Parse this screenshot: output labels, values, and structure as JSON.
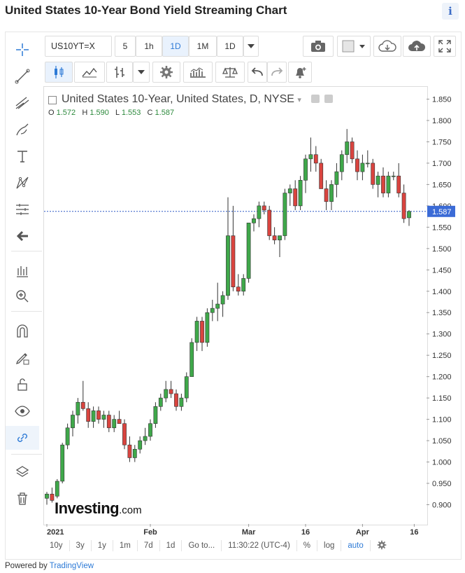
{
  "page_title": "United States 10-Year Bond Yield Streaming Chart",
  "info_icon_glyph": "i",
  "toolbar": {
    "symbol": "US10YT=X",
    "intervals": [
      "5",
      "1h",
      "1D",
      "1M",
      "1D"
    ],
    "selected_interval": "1D",
    "icons": [
      "camera-icon",
      "color-square-icon",
      "dropdown-arrow-icon",
      "cloud-download-icon",
      "cloud-upload-icon",
      "fullscreen-icon"
    ]
  },
  "second_toolbar_icons": [
    "candle-style-icon",
    "indicator-icon",
    "bar-type-icon",
    "dropdown-arrow-icon",
    "gear-icon",
    "compare-icon",
    "scale-icon",
    "undo-icon",
    "redo-icon",
    "alert-icon"
  ],
  "left_tools": [
    "crosshair-icon",
    "trend-line-icon",
    "pitchfork-icon",
    "brush-icon",
    "text-icon",
    "pattern-icon",
    "measure-icon",
    "back-arrow-icon",
    "indicators-icon",
    "zoom-in-icon",
    "magnet-icon",
    "lock-draw-icon",
    "unlock-icon",
    "eye-icon",
    "link-icon",
    "layers-icon",
    "trash-icon"
  ],
  "legend": {
    "title": "United States 10-Year, United States, D, NYSE",
    "o_label": "O",
    "o": "1.572",
    "h_label": "H",
    "h": "1.590",
    "l_label": "L",
    "l": "1.553",
    "c_label": "C",
    "c": "1.587"
  },
  "logo_text": "Investing",
  "logo_suffix": ".com",
  "bottom_bar": {
    "ranges": [
      "10y",
      "3y",
      "1y",
      "1m",
      "7d",
      "1d"
    ],
    "goto": "Go to...",
    "time": "11:30:22 (UTC-4)",
    "percent": "%",
    "log": "log",
    "auto": "auto"
  },
  "powered_by": "Powered by",
  "powered_brand": "TradingView",
  "colors": {
    "up": "#3fa84a",
    "down": "#d9443f",
    "price_line": "#2d59c6",
    "label_bg": "#3b6bd6"
  },
  "chart_data": {
    "type": "candlestick",
    "title": "United States 10-Year, United States, D, NYSE",
    "current_price": 1.587,
    "current_price_label": "1.587",
    "ylim": [
      0.87,
      1.87
    ],
    "yticks": [
      "0.900",
      "0.950",
      "1.000",
      "1.050",
      "1.100",
      "1.150",
      "1.200",
      "1.250",
      "1.300",
      "1.350",
      "1.400",
      "1.450",
      "1.500",
      "1.550",
      "1.600",
      "1.650",
      "1.700",
      "1.750",
      "1.800",
      "1.850"
    ],
    "xtick_labels": [
      "2021",
      "Feb",
      "Mar",
      "16",
      "Apr",
      "16"
    ],
    "xtick_index": [
      0,
      20,
      39,
      50,
      61,
      71
    ],
    "ohlc": [
      [
        0.915,
        0.93,
        0.9,
        0.925
      ],
      [
        0.925,
        0.94,
        0.905,
        0.91
      ],
      [
        0.92,
        0.96,
        0.915,
        0.955
      ],
      [
        0.955,
        1.045,
        0.95,
        1.04
      ],
      [
        1.04,
        1.09,
        1.03,
        1.08
      ],
      [
        1.08,
        1.12,
        1.06,
        1.11
      ],
      [
        1.11,
        1.15,
        1.09,
        1.14
      ],
      [
        1.14,
        1.19,
        1.12,
        1.125
      ],
      [
        1.125,
        1.14,
        1.08,
        1.095
      ],
      [
        1.095,
        1.13,
        1.08,
        1.12
      ],
      [
        1.12,
        1.13,
        1.09,
        1.1
      ],
      [
        1.1,
        1.12,
        1.08,
        1.11
      ],
      [
        1.11,
        1.12,
        1.07,
        1.08
      ],
      [
        1.08,
        1.11,
        1.07,
        1.1
      ],
      [
        1.1,
        1.12,
        1.09,
        1.09
      ],
      [
        1.09,
        1.1,
        1.03,
        1.04
      ],
      [
        1.04,
        1.06,
        1.0,
        1.01
      ],
      [
        1.01,
        1.04,
        1.0,
        1.03
      ],
      [
        1.03,
        1.06,
        1.02,
        1.05
      ],
      [
        1.05,
        1.08,
        1.04,
        1.06
      ],
      [
        1.06,
        1.1,
        1.05,
        1.09
      ],
      [
        1.09,
        1.14,
        1.08,
        1.13
      ],
      [
        1.13,
        1.16,
        1.12,
        1.15
      ],
      [
        1.15,
        1.19,
        1.14,
        1.17
      ],
      [
        1.17,
        1.19,
        1.15,
        1.16
      ],
      [
        1.16,
        1.17,
        1.12,
        1.13
      ],
      [
        1.13,
        1.16,
        1.12,
        1.15
      ],
      [
        1.15,
        1.21,
        1.14,
        1.2
      ],
      [
        1.2,
        1.29,
        1.22,
        1.28
      ],
      [
        1.28,
        1.34,
        1.26,
        1.33
      ],
      [
        1.33,
        1.34,
        1.26,
        1.28
      ],
      [
        1.28,
        1.36,
        1.27,
        1.35
      ],
      [
        1.35,
        1.38,
        1.33,
        1.36
      ],
      [
        1.36,
        1.42,
        1.33,
        1.37
      ],
      [
        1.37,
        1.4,
        1.34,
        1.39
      ],
      [
        1.39,
        1.62,
        1.38,
        1.53
      ],
      [
        1.53,
        1.6,
        1.4,
        1.41
      ],
      [
        1.41,
        1.44,
        1.39,
        1.4
      ],
      [
        1.4,
        1.44,
        1.39,
        1.43
      ],
      [
        1.43,
        1.56,
        1.42,
        1.56
      ],
      [
        1.56,
        1.58,
        1.54,
        1.57
      ],
      [
        1.57,
        1.61,
        1.55,
        1.6
      ],
      [
        1.6,
        1.61,
        1.58,
        1.59
      ],
      [
        1.59,
        1.6,
        1.52,
        1.53
      ],
      [
        1.53,
        1.55,
        1.51,
        1.52
      ],
      [
        1.52,
        1.53,
        1.48,
        1.53
      ],
      [
        1.53,
        1.64,
        1.52,
        1.63
      ],
      [
        1.63,
        1.65,
        1.6,
        1.64
      ],
      [
        1.64,
        1.66,
        1.59,
        1.6
      ],
      [
        1.6,
        1.67,
        1.59,
        1.66
      ],
      [
        1.66,
        1.72,
        1.63,
        1.71
      ],
      [
        1.71,
        1.76,
        1.68,
        1.72
      ],
      [
        1.72,
        1.74,
        1.68,
        1.7
      ],
      [
        1.7,
        1.71,
        1.64,
        1.64
      ],
      [
        1.64,
        1.66,
        1.59,
        1.61
      ],
      [
        1.61,
        1.66,
        1.59,
        1.65
      ],
      [
        1.65,
        1.7,
        1.62,
        1.68
      ],
      [
        1.68,
        1.73,
        1.66,
        1.72
      ],
      [
        1.72,
        1.78,
        1.7,
        1.75
      ],
      [
        1.75,
        1.76,
        1.7,
        1.71
      ],
      [
        1.71,
        1.73,
        1.66,
        1.68
      ],
      [
        1.68,
        1.72,
        1.66,
        1.7
      ],
      [
        1.7,
        1.73,
        1.69,
        1.7
      ],
      [
        1.7,
        1.71,
        1.64,
        1.65
      ],
      [
        1.65,
        1.68,
        1.62,
        1.67
      ],
      [
        1.67,
        1.69,
        1.62,
        1.63
      ],
      [
        1.63,
        1.68,
        1.62,
        1.67
      ],
      [
        1.67,
        1.68,
        1.66,
        1.67
      ],
      [
        1.67,
        1.7,
        1.62,
        1.63
      ],
      [
        1.63,
        1.65,
        1.56,
        1.57
      ],
      [
        1.572,
        1.59,
        1.553,
        1.587
      ]
    ]
  }
}
